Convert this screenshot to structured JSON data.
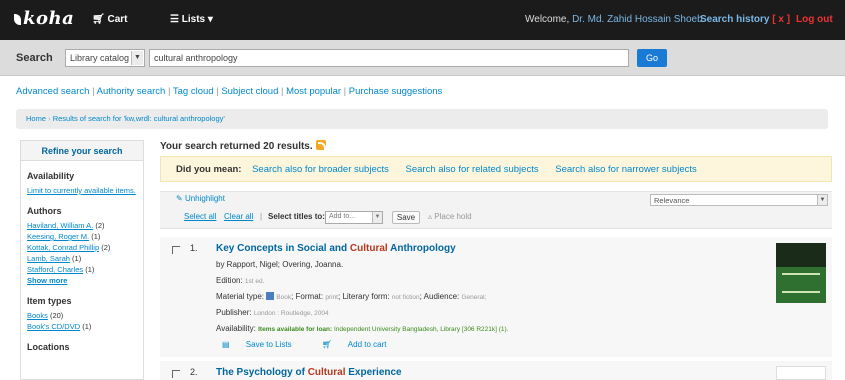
{
  "topbar": {
    "logo": "koha",
    "cart": "Cart",
    "lists": "Lists",
    "welcome": "Welcome,",
    "user": "Dr. Md. Zahid Hossain Shoeb",
    "search_history": "Search history",
    "history_clear": "[ x ]",
    "logout": "Log out"
  },
  "search": {
    "label": "Search",
    "scope": "Library catalog",
    "query": "cultural anthropology",
    "go": "Go"
  },
  "sublinks": [
    "Advanced search",
    "Authority search",
    "Tag cloud",
    "Subject cloud",
    "Most popular",
    "Purchase suggestions"
  ],
  "breadcrumb": {
    "home": "Home",
    "current": "Results of search for 'kw,wrdl: cultural anthropology'"
  },
  "sidebar": {
    "refine": "Refine your search",
    "availability_head": "Availability",
    "availability_link": "Limit to currently available items.",
    "authors_head": "Authors",
    "authors": [
      {
        "name": "Haviland, William A.",
        "count": "(2)"
      },
      {
        "name": "Keesing, Roger M.",
        "count": "(1)"
      },
      {
        "name": "Kottak, Conrad Phillip",
        "count": "(2)"
      },
      {
        "name": "Lamb, Sarah",
        "count": "(1)"
      },
      {
        "name": "Stafford, Charles",
        "count": "(1)"
      }
    ],
    "show_more": "Show more",
    "item_types_head": "Item types",
    "item_types": [
      {
        "name": "Books",
        "count": "(20)"
      },
      {
        "name": "Book's CD/DVD",
        "count": "(1)"
      }
    ],
    "locations_head": "Locations"
  },
  "results": {
    "summary": "Your search returned 20 results.",
    "did_you_mean": "Did you mean:",
    "suggestions": [
      "Search also for broader subjects",
      "Search also for related subjects",
      "Search also for narrower subjects"
    ],
    "unhighlight": "Unhighlight",
    "sort": "Relevance",
    "select_all": "Select all",
    "clear_all": "Clear all",
    "select_titles_to": "Select titles to:",
    "add_to": "Add to...",
    "save": "Save",
    "place_hold": "Place hold"
  },
  "items": [
    {
      "number": "1.",
      "title_pre": "Key Concepts in Social and ",
      "title_hl": "Cultural",
      "title_post": " Anthropology",
      "byline": "by Rapport, Nigel; Overing, Joanna.",
      "edition_label": "Edition:",
      "edition": "1st ed.",
      "material_label": "Material type:",
      "material": "Book",
      "format_label": "Format:",
      "format": "print",
      "literary_label": "Literary form:",
      "literary": "not fiction",
      "audience_label": "Audience:",
      "audience": "General;",
      "publisher_label": "Publisher:",
      "publisher": "London : Routledge, 2004",
      "availability_label": "Availability:",
      "availability_bold": "Items available for loan:",
      "availability_text": "Independent University Bangladesh, Library [306 R221k] (1).",
      "save_to_lists": "Save to Lists",
      "add_to_cart": "Add to cart"
    },
    {
      "number": "2.",
      "title_pre": "The Psychology of ",
      "title_hl": "Cultural",
      "title_post": " Experience"
    }
  ],
  "colors": {
    "topbar": "#1b1b1b",
    "link": "#0088cc",
    "highlight": "#b5391e",
    "go_button": "#1a7bd4",
    "did_you_mean_bg": "#fdf6dd"
  }
}
